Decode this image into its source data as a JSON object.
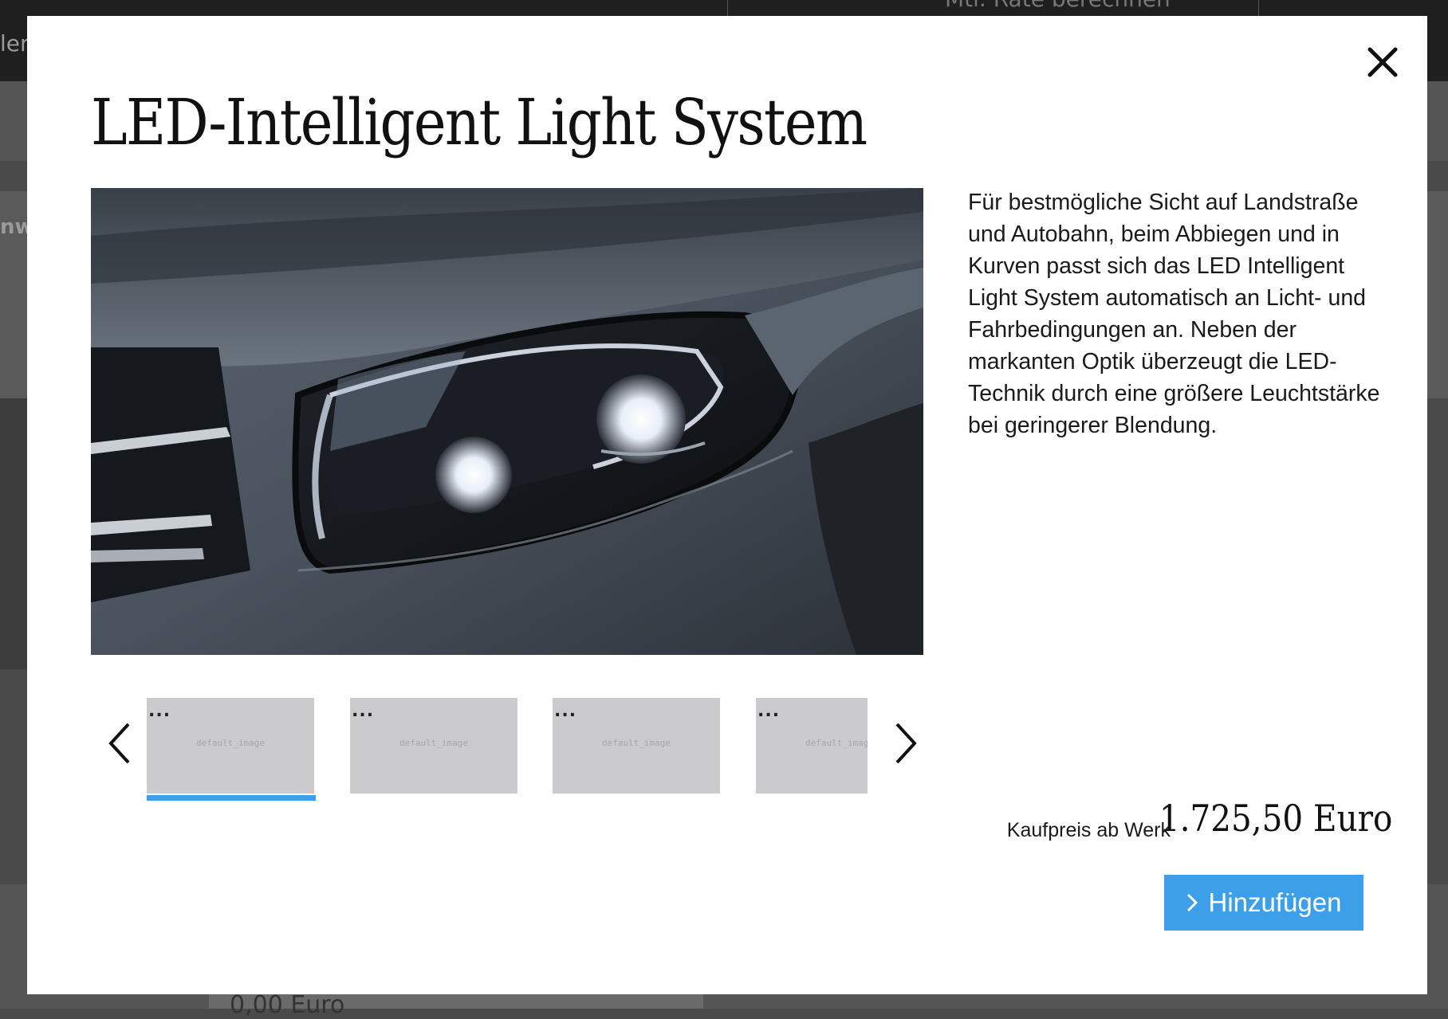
{
  "background": {
    "topbar_text": "Mtl. Rate berechnen",
    "left_fragment_1": "ler",
    "left_fragment_2": "nw",
    "bottom_price": "0,00 Euro"
  },
  "modal": {
    "title": "LED-Intelligent Light System",
    "close_icon": "close-icon",
    "main_image_alt": "LED headlight",
    "description": "Für bestmögliche Sicht auf Landstraße und Autobahn, beim Abbiegen und in Kurven passt sich das LED Intelligent Light System automatisch an Licht- und Fahrbedingungen an. Neben der markanten Optik überzeugt die LED-Technik durch eine größere Leuchtstärke bei geringerer Blendung.",
    "thumbnails": [
      {
        "dots": "...",
        "label": "default_image",
        "active": true
      },
      {
        "dots": "...",
        "label": "default_image",
        "active": false
      },
      {
        "dots": "...",
        "label": "default_image",
        "active": false
      },
      {
        "dots": "...",
        "label": "default_image",
        "active": false
      }
    ],
    "prev_icon": "chevron-left-icon",
    "next_icon": "chevron-right-icon",
    "price_label": "Kaufpreis ab Werk",
    "price_value": "1.725,50 Euro",
    "add_button_label": "Hinzufügen",
    "colors": {
      "accent": "#3d9fe8",
      "thumb_bg": "#cbcbcd",
      "overlay": "#4a4a4a"
    }
  }
}
